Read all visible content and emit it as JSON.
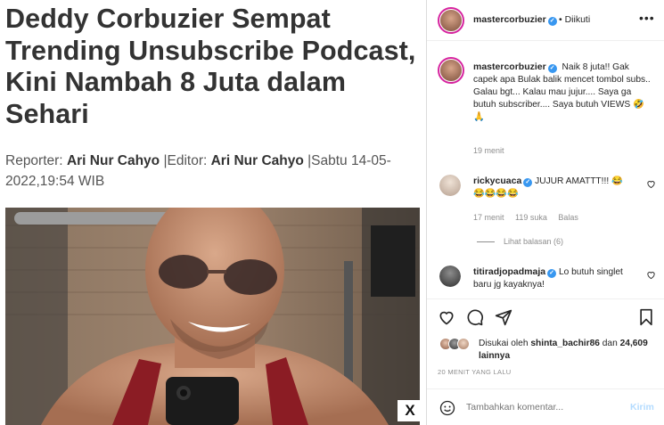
{
  "article": {
    "headline": "Deddy Corbuzier Sempat Trending Unsubscribe Podcast, Kini Nambah 8 Juta dalam Sehari",
    "reporter_label": "Reporter:",
    "reporter_name": "Ari Nur Cahyo",
    "editor_label": "|Editor:",
    "editor_name": "Ari Nur Cahyo",
    "date": "|Sabtu 14-05-2022,19:54 WIB",
    "close_label": "X"
  },
  "post": {
    "header": {
      "username": "mastercorbuzier",
      "verified_mark": "✓",
      "follow_status": "• Diikuti",
      "more_label": "•••"
    },
    "caption": {
      "username": "mastercorbuzier",
      "text": "Naik 8 juta!! Gak capek apa Bulak balik mencet tombol subs.. Galau bgt... Kalau mau jujur.... Saya ga butuh subscriber.... Saya butuh VIEWS 🤣🙏",
      "time": "19 menit"
    },
    "comments": [
      {
        "username": "rickycuaca",
        "text": "JUJUR AMATTT!!! 😂 😂😂😂😂",
        "time": "17 menit",
        "likes": "119 suka",
        "reply": "Balas",
        "view_replies": "Lihat balasan (6)"
      },
      {
        "username": "titiradjopadmaja",
        "text": "Lo butuh singlet baru jg kayaknya!"
      }
    ],
    "liked_by_prefix": "Disukai oleh",
    "liked_by_user": "shinta_bachir86",
    "liked_by_and": "dan",
    "liked_by_count": "24,609 lainnya",
    "posted_ago": "20 MENIT YANG LALU",
    "comment_placeholder": "Tambahkan komentar...",
    "post_button": "Kirim"
  },
  "icons": {
    "heart": "heart-icon",
    "comment": "comment-icon",
    "share": "share-icon",
    "save": "bookmark-icon",
    "emoji": "emoji-icon"
  },
  "colors": {
    "verified": "#3897f0",
    "link_disabled": "#b3dbff",
    "story_ring": "#d6249f"
  }
}
